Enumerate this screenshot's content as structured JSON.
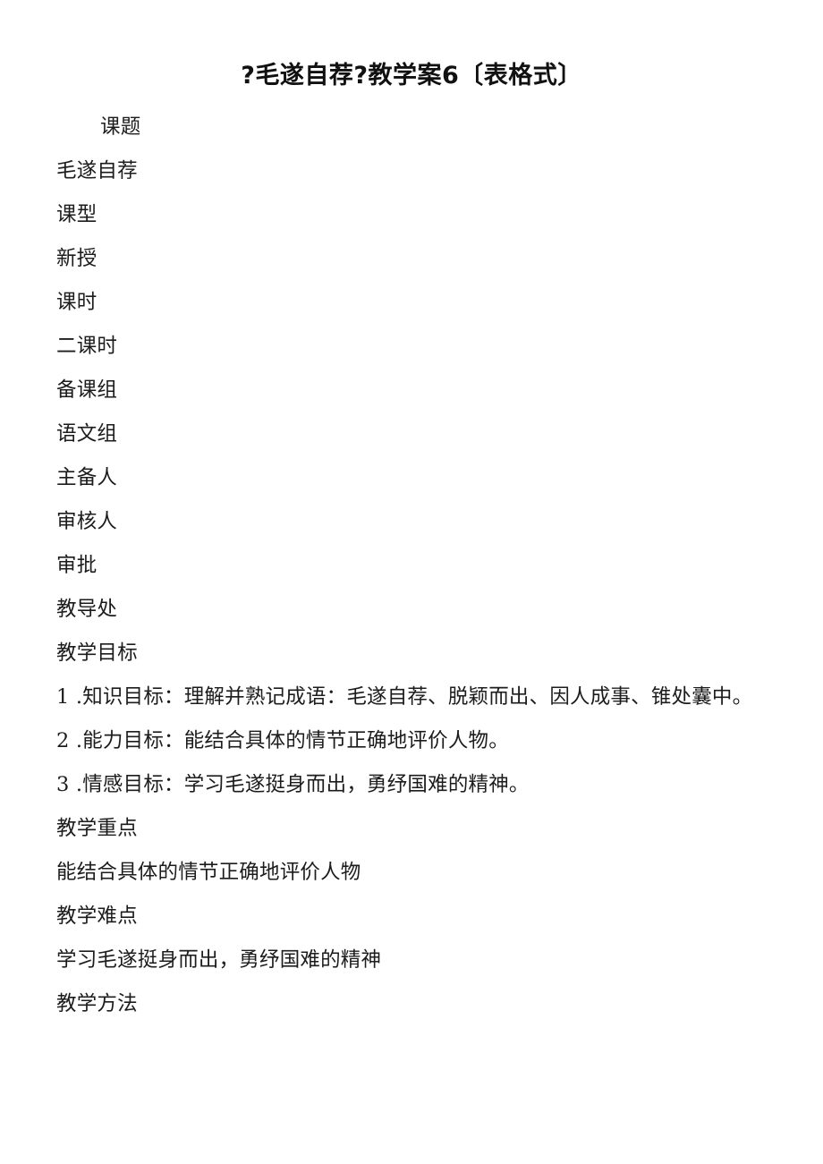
{
  "document": {
    "title": "?毛遂自荐?教学案6〔表格式〕",
    "lines": [
      {
        "text": "课题",
        "indent": true
      },
      {
        "text": "毛遂自荐",
        "indent": false
      },
      {
        "text": "课型",
        "indent": false
      },
      {
        "text": "新授",
        "indent": false
      },
      {
        "text": "课时",
        "indent": false
      },
      {
        "text": "二课时",
        "indent": false
      },
      {
        "text": "备课组",
        "indent": false
      },
      {
        "text": "语文组",
        "indent": false
      },
      {
        "text": "主备人",
        "indent": false
      },
      {
        "text": "审核人",
        "indent": false
      },
      {
        "text": "审批",
        "indent": false
      },
      {
        "text": "教导处",
        "indent": false
      },
      {
        "text": "教学目标",
        "indent": false
      },
      {
        "text": "1 .知识目标：理解并熟记成语：毛遂自荐、脱颖而出、因人成事、锥处囊中。",
        "indent": false
      },
      {
        "text": "2 .能力目标：能结合具体的情节正确地评价人物。",
        "indent": false
      },
      {
        "text": "3 .情感目标：学习毛遂挺身而出，勇纾国难的精神。",
        "indent": false
      },
      {
        "text": "教学重点",
        "indent": false
      },
      {
        "text": "能结合具体的情节正确地评价人物",
        "indent": false
      },
      {
        "text": "教学难点",
        "indent": false
      },
      {
        "text": "学习毛遂挺身而出，勇纾国难的精神",
        "indent": false
      },
      {
        "text": "教学方法",
        "indent": false
      }
    ]
  }
}
